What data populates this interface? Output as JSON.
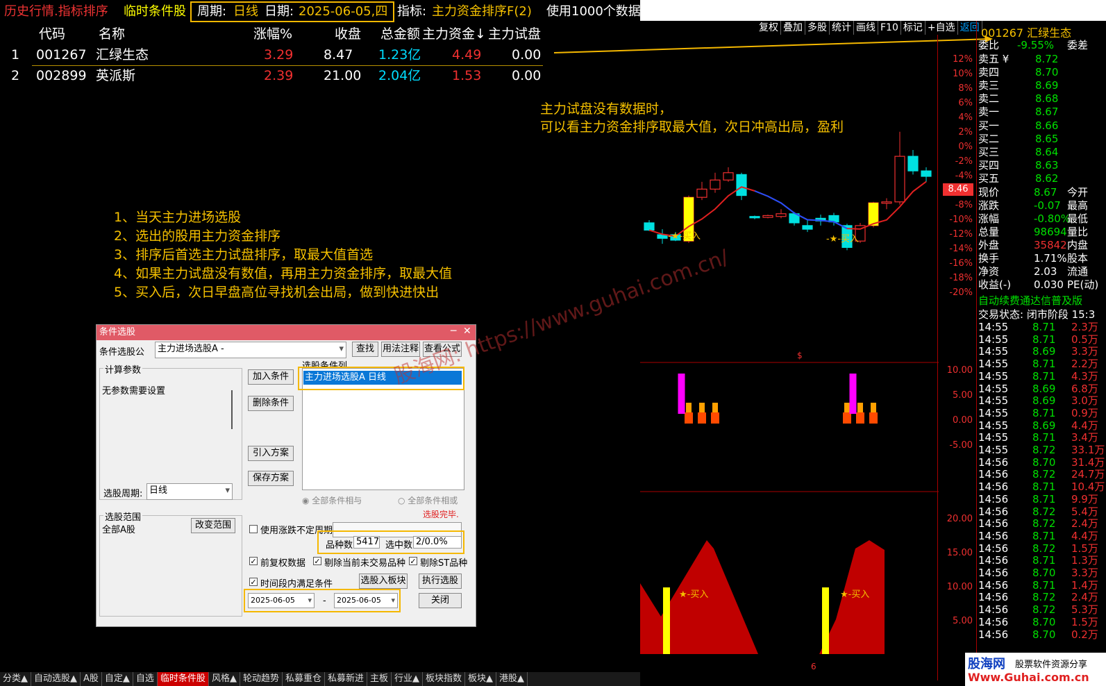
{
  "topbar": {
    "title": "历史行情.指标排序",
    "mode": "临时条件股",
    "period_label": "周期:",
    "period_value": "日线",
    "date_label": "日期:",
    "date_value": "2025-06-05,四",
    "indicator_label": "指标:",
    "indicator_value": "主力资金排序F(2)",
    "note": "使用1000个数据"
  },
  "table": {
    "headers": [
      "代码",
      "名称",
      "涨幅%",
      "收盘",
      "总金额",
      "主力资金↓",
      "主力试盘"
    ],
    "rows": [
      {
        "idx": "1",
        "code": "001267",
        "name": "汇绿生态",
        "chg": "3.29",
        "close": "8.47",
        "amount": "1.23亿",
        "fund": "4.49",
        "trial": "0.00"
      },
      {
        "idx": "2",
        "code": "002899",
        "name": "英派斯",
        "chg": "2.39",
        "close": "21.00",
        "amount": "2.04亿",
        "fund": "1.53",
        "trial": "0.00"
      }
    ]
  },
  "instructions": [
    "1、当天主力进场选股",
    "2、选出的股用主力资金排序",
    "3、排序后首选主力试盘排序，取最大值首选",
    "4、如果主力试盘没有数值，再用主力资金排序，取最大值",
    "5、买入后，次日早盘高位寻找机会出局，做到快进快出"
  ],
  "annotation": {
    "line1": "主力试盘没有数据时，",
    "line2": "可以看主力资金排序取最大值，次日冲高出局，盈利"
  },
  "dialog": {
    "title": "条件选股",
    "formula_label": "条件选股公",
    "formula_value": "主力进场选股A  -",
    "btn_find": "查找",
    "btn_usage": "用法注释",
    "btn_view": "查看公式",
    "params_group": "计算参数",
    "params_text": "无参数需要设置",
    "btn_add": "加入条件",
    "btn_delete": "删除条件",
    "btn_import": "引入方案",
    "btn_save": "保存方案",
    "cond_group": "选股条件列",
    "cond_item": "主力进场选股A  日线",
    "period_label": "选股周期:",
    "period_value": "日线",
    "radio_and": "全部条件相与",
    "radio_or": "全部条件相或",
    "done": "选股完毕.",
    "range_group": "选股范围",
    "range_value": "全部A股",
    "btn_range": "改变范围",
    "chk_uncertain": "使用涨跌不定周期",
    "count_label": "品种数",
    "count_value": "5417",
    "selected_label": "选中数",
    "selected_value": "2/0.0%",
    "chk_adjust": "前复权数据",
    "chk_exclude_untraded": "剔除当前未交易品种",
    "chk_exclude_st": "剔除ST品种",
    "chk_timerange": "时间段内满足条件",
    "btn_to_block": "选股入板块",
    "btn_run": "执行选股",
    "date_from": "2025-06-05",
    "date_sep": "-",
    "date_to": "2025-06-05",
    "btn_close": "关闭"
  },
  "chart": {
    "toolbar": [
      "复权",
      "叠加",
      "多股",
      "统计",
      "画线",
      "F10",
      "标记",
      "+自选",
      "返回"
    ],
    "price_axis": [
      "12%",
      "10%",
      "8%",
      "6%",
      "4%",
      "2%",
      "0%",
      "-2%",
      "-4%",
      "-6%",
      "-8%",
      "-10%",
      "-12%",
      "-14%",
      "-16%",
      "-18%",
      "-20%"
    ],
    "price_marker": "8.46",
    "buy_label": "★-买入",
    "buy_label_prefix": "-★-买入",
    "panel2_axis": [
      "10.00",
      "5.00",
      "0.00",
      "-5.00"
    ],
    "panel3_axis": [
      "20.00",
      "15.00",
      "10.00",
      "5.00"
    ],
    "dollar_mark": "$",
    "bottom_mark": "6",
    "candles": [
      {
        "o": 8.25,
        "h": 8.28,
        "l": 8.16,
        "c": 8.17
      },
      {
        "o": 8.12,
        "h": 8.18,
        "l": 8.02,
        "c": 8.08
      },
      {
        "o": 8.12,
        "h": 8.15,
        "l": 8.05,
        "c": 8.06
      },
      {
        "o": 8.05,
        "h": 8.55,
        "l": 8.03,
        "c": 8.53
      },
      {
        "o": 8.53,
        "h": 8.7,
        "l": 8.5,
        "c": 8.62
      },
      {
        "o": 8.62,
        "h": 8.8,
        "l": 8.58,
        "c": 8.72
      },
      {
        "o": 8.72,
        "h": 8.86,
        "l": 8.7,
        "c": 8.8
      },
      {
        "o": 8.78,
        "h": 8.8,
        "l": 8.5,
        "c": 8.55
      },
      {
        "o": 8.32,
        "h": 8.33,
        "l": 8.29,
        "c": 8.31
      },
      {
        "o": 8.31,
        "h": 8.34,
        "l": 8.3,
        "c": 8.33
      },
      {
        "o": 8.32,
        "h": 8.4,
        "l": 8.3,
        "c": 8.35
      },
      {
        "o": 8.35,
        "h": 8.37,
        "l": 8.22,
        "c": 8.25
      },
      {
        "o": 8.22,
        "h": 8.28,
        "l": 8.15,
        "c": 8.18
      },
      {
        "o": 8.3,
        "h": 8.34,
        "l": 8.22,
        "c": 8.27
      },
      {
        "o": 8.33,
        "h": 8.36,
        "l": 8.22,
        "c": 8.26
      },
      {
        "o": 8.22,
        "h": 8.24,
        "l": 7.95,
        "c": 7.98
      },
      {
        "o": 8.05,
        "h": 8.25,
        "l": 8.03,
        "c": 8.22
      },
      {
        "o": 8.22,
        "h": 8.48,
        "l": 8.2,
        "c": 8.47
      },
      {
        "o": 8.47,
        "h": 8.52,
        "l": 8.4,
        "c": 8.48
      },
      {
        "o": 8.48,
        "h": 9.25,
        "l": 8.45,
        "c": 8.98
      },
      {
        "o": 8.98,
        "h": 9.05,
        "l": 8.78,
        "c": 8.82
      },
      {
        "o": 8.82,
        "h": 8.86,
        "l": 8.7,
        "c": 8.76
      }
    ]
  },
  "quote": {
    "header": "001267 汇绿生态",
    "webi_label": "委比",
    "webi_value": "-9.55%",
    "weicha_label": "委差",
    "sells": [
      {
        "label": "卖五 ¥",
        "price": "8.72"
      },
      {
        "label": "卖四",
        "price": "8.70"
      },
      {
        "label": "卖三",
        "price": "8.69"
      },
      {
        "label": "卖二",
        "price": "8.68"
      },
      {
        "label": "卖一",
        "price": "8.67"
      }
    ],
    "buys": [
      {
        "label": "买一",
        "price": "8.66"
      },
      {
        "label": "买二",
        "price": "8.65"
      },
      {
        "label": "买三",
        "price": "8.64"
      },
      {
        "label": "买四",
        "price": "8.63"
      },
      {
        "label": "买五",
        "price": "8.62"
      }
    ],
    "stats": [
      {
        "l": "现价",
        "v": "8.67",
        "r": "今开",
        "color": "green"
      },
      {
        "l": "涨跌",
        "v": "-0.07",
        "r": "最高",
        "color": "green"
      },
      {
        "l": "涨幅",
        "v": "-0.80%",
        "r": "最低",
        "color": "green"
      },
      {
        "l": "总量",
        "v": "98694",
        "r": "量比",
        "color": "green"
      },
      {
        "l": "外盘",
        "v": "35842",
        "r": "内盘",
        "color": "red"
      },
      {
        "l": "换手",
        "v": "1.71%",
        "r": "股本",
        "color": "white"
      },
      {
        "l": "净资",
        "v": "2.03",
        "r": "流通",
        "color": "white"
      },
      {
        "l": "收益(-)",
        "v": "0.030",
        "r": "PE(动)",
        "color": "white"
      }
    ],
    "ad": "自动续费通达信普及版",
    "trade_status": "交易状态: 闭市阶段 15:3",
    "ticks": [
      [
        "14:55",
        "8.71",
        "2.3万"
      ],
      [
        "14:55",
        "8.71",
        "0.5万"
      ],
      [
        "14:55",
        "8.69",
        "3.3万"
      ],
      [
        "14:55",
        "8.71",
        "2.2万"
      ],
      [
        "14:55",
        "8.71",
        "4.3万"
      ],
      [
        "14:55",
        "8.69",
        "6.8万"
      ],
      [
        "14:55",
        "8.69",
        "3.0万"
      ],
      [
        "14:55",
        "8.71",
        "0.9万"
      ],
      [
        "14:55",
        "8.69",
        "4.4万"
      ],
      [
        "14:55",
        "8.71",
        "3.4万"
      ],
      [
        "14:55",
        "8.72",
        "33.1万"
      ],
      [
        "14:56",
        "8.70",
        "31.4万"
      ],
      [
        "14:56",
        "8.72",
        "24.7万"
      ],
      [
        "14:56",
        "8.71",
        "10.4万"
      ],
      [
        "14:56",
        "8.71",
        "9.9万"
      ],
      [
        "14:56",
        "8.72",
        "5.4万"
      ],
      [
        "14:56",
        "8.72",
        "2.4万"
      ],
      [
        "14:56",
        "8.71",
        "4.4万"
      ],
      [
        "14:56",
        "8.72",
        "1.5万"
      ],
      [
        "14:56",
        "8.71",
        "1.3万"
      ],
      [
        "14:56",
        "8.70",
        "3.3万"
      ],
      [
        "14:56",
        "8.71",
        "1.4万"
      ],
      [
        "14:56",
        "8.72",
        "2.4万"
      ],
      [
        "14:56",
        "8.72",
        "5.3万"
      ],
      [
        "14:56",
        "8.70",
        "1.5万"
      ],
      [
        "14:56",
        "8.70",
        "0.2万"
      ]
    ]
  },
  "tabs": [
    "分类▲",
    "自动选股▲",
    "A股",
    "自定▲",
    "自选",
    "临时条件股",
    "风格▲",
    "轮动趋势",
    "私募重仓",
    "私募新进",
    "主板",
    "行业▲",
    "板块指数",
    "板块▲",
    "港股▲"
  ],
  "active_tab": 5,
  "watermark": "股海网: https://www.guhai.com.cn/",
  "logo": {
    "line1": "股海网",
    "line2": "股票软件资源分享",
    "line3": "Www.Guhai.com.cn"
  },
  "colors": {
    "up": "#f03030",
    "down": "#00e0e0",
    "accent": "#f5c000",
    "ma": "#e02020"
  }
}
